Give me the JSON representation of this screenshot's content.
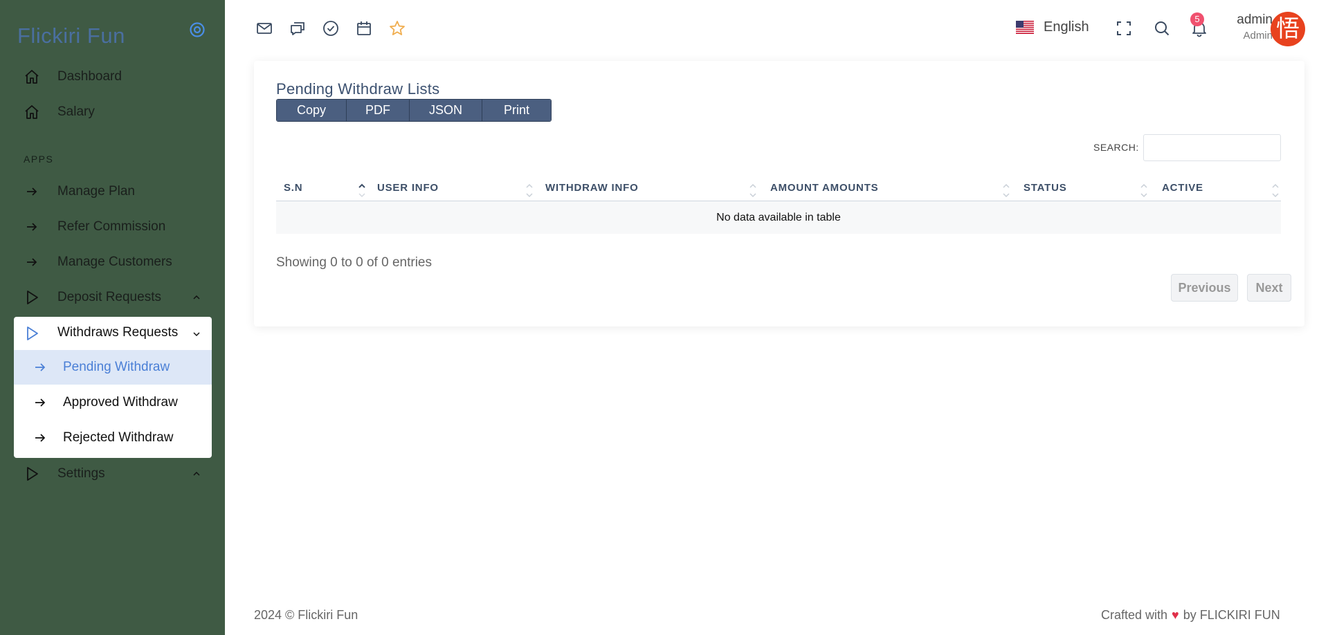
{
  "sidebar": {
    "brand": "Flickiri Fun",
    "items": [
      {
        "label": "Dashboard",
        "icon": "home-icon"
      },
      {
        "label": "Salary",
        "icon": "home-icon"
      }
    ],
    "section_title": "APPS",
    "apps": [
      {
        "label": "Manage Plan",
        "icon": "arrow-right-icon"
      },
      {
        "label": "Refer Commission",
        "icon": "arrow-right-icon"
      },
      {
        "label": "Manage Customers",
        "icon": "arrow-right-icon"
      },
      {
        "label": "Deposit Requests",
        "icon": "play-icon"
      }
    ],
    "withdraws": {
      "label": "Withdraws Requests",
      "children": [
        {
          "label": "Pending Withdraw",
          "active": true
        },
        {
          "label": "Approved Withdraw"
        },
        {
          "label": "Rejected Withdraw"
        }
      ]
    },
    "settings": {
      "label": "Settings"
    }
  },
  "topbar": {
    "icons": [
      "mail-icon",
      "chat-icon",
      "check-circle-icon",
      "calendar-icon",
      "star-icon"
    ],
    "language": "English",
    "notification_count": "5",
    "user_name": "admin",
    "user_role": "Admin",
    "avatar_char": "悟"
  },
  "card": {
    "title": "Pending Withdraw Lists",
    "buttons": [
      "Copy",
      "PDF",
      "JSON",
      "Print"
    ],
    "search_label": "SEARCH:",
    "columns": [
      "S.N",
      "USER INFO",
      "WITHDRAW INFO",
      "AMOUNT AMOUNTS",
      "STATUS",
      "ACTIVE"
    ],
    "empty_message": "No data available in table",
    "info": "Showing 0 to 0 of 0 entries",
    "prev": "Previous",
    "next": "Next"
  },
  "footer": {
    "left": "2024 © Flickiri Fun",
    "right_pre": "Crafted with",
    "right_post": "by FLICKIRI FUN"
  },
  "colors": {
    "sidebar_bg": "#3f5a44",
    "brand": "#4a6fa0",
    "active_item_bg": "#dde7f7",
    "active_item_text": "#4a7fd6",
    "button_bg": "#4b5f80",
    "badge": "#f0506e",
    "avatar": "#e8421e",
    "star": "#f0ad4e"
  }
}
